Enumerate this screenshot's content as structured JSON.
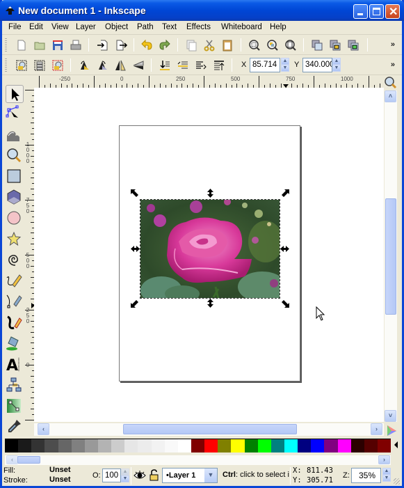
{
  "window": {
    "title": "New document 1 - Inkscape",
    "controls": [
      "minimize",
      "maximize",
      "close"
    ]
  },
  "menu": [
    {
      "label": "File",
      "accel": "F"
    },
    {
      "label": "Edit",
      "accel": "E"
    },
    {
      "label": "View",
      "accel": "V"
    },
    {
      "label": "Layer",
      "accel": "L"
    },
    {
      "label": "Object",
      "accel": "O"
    },
    {
      "label": "Path",
      "accel": "P"
    },
    {
      "label": "Text",
      "accel": "T"
    },
    {
      "label": "Effects",
      "accel": "c"
    },
    {
      "label": "Whiteboard",
      "accel": "d"
    },
    {
      "label": "Help",
      "accel": "H"
    }
  ],
  "commands_toolbar": {
    "buttons": [
      "new-document-icon",
      "open-icon",
      "save-icon",
      "print-icon",
      "import-icon",
      "export-icon",
      "undo-icon",
      "redo-icon",
      "duplicate-icon",
      "cut-icon",
      "paste-icon",
      "zoom-selection-icon",
      "zoom-drawing-icon",
      "zoom-page-icon",
      "group-icon",
      "lock-icon",
      "unlock-icon"
    ],
    "overflow": "»"
  },
  "select_toolbar": {
    "buttons": [
      "select-all-icon",
      "select-all-layers-icon",
      "deselect-icon",
      "rotate-ccw-icon",
      "rotate-cw-icon",
      "flip-horizontal-icon",
      "flip-vertical-icon",
      "lower-to-bottom-icon",
      "lower-icon",
      "raise-icon",
      "raise-to-top-icon"
    ],
    "x_label": "X",
    "x_value": "85.714",
    "y_label": "Y",
    "y_value": "340.000",
    "overflow": "»"
  },
  "tools": [
    "selector",
    "node-editor",
    "tweak",
    "zoom",
    "rectangle",
    "3d-box",
    "ellipse",
    "star",
    "spiral",
    "pencil",
    "pen",
    "calligraphy",
    "paint-bucket",
    "text",
    "connector",
    "gradient",
    "dropper"
  ],
  "rulers": {
    "horizontal": [
      "-250",
      "0",
      "250",
      "500",
      "750",
      "1000"
    ],
    "vertical": [
      "1000",
      "750",
      "500",
      "250",
      "0"
    ]
  },
  "palette": [
    "#000000",
    "#1a1a1a",
    "#333333",
    "#4d4d4d",
    "#666666",
    "#808080",
    "#999999",
    "#b3b3b3",
    "#cccccc",
    "#e6e6e6",
    "#ececec",
    "#f2f2f2",
    "#f9f9f9",
    "#ffffff",
    "#800000",
    "#ff0000",
    "#808000",
    "#ffff00",
    "#008000",
    "#00ff00",
    "#008080",
    "#00ffff",
    "#000080",
    "#0000ff",
    "#800080",
    "#ff00ff",
    "#2b0000",
    "#550000",
    "#800000"
  ],
  "status": {
    "fill_label": "Fill:",
    "fill_value": "Unset",
    "stroke_label": "Stroke:",
    "stroke_value": "Unset",
    "opacity_label": "O:",
    "opacity_value": "100",
    "layer": "•Layer 1",
    "message_key": "Ctrl",
    "message": ": click to select i.",
    "x_label": "X:",
    "x_value": "811.43",
    "y_label": "Y:",
    "y_value": "305.71",
    "zoom_label": "Z:",
    "zoom_value": "35%"
  }
}
